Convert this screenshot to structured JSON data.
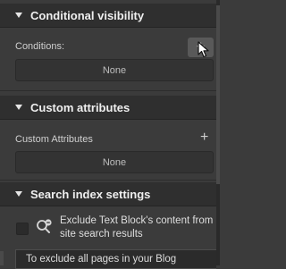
{
  "conditional_visibility": {
    "title": "Conditional visibility",
    "conditions_label": "Conditions:",
    "add_button_symbol": "+",
    "value": "None"
  },
  "custom_attributes": {
    "title": "Custom attributes",
    "label": "Custom Attributes",
    "add_button_symbol": "+",
    "value": "None"
  },
  "search_index": {
    "title": "Search index settings",
    "exclude_label": "Exclude Text Block's content from site search results",
    "exclude_checked": false,
    "note": "To exclude all pages in your Blog"
  }
}
